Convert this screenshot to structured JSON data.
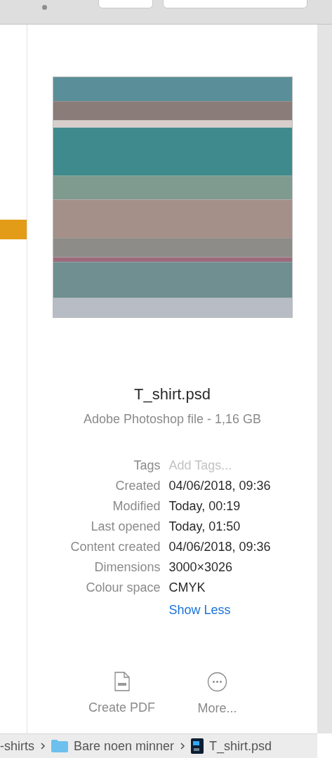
{
  "file": {
    "name": "T_shirt.psd",
    "subtitle": "Adobe Photoshop file - 1,16 GB"
  },
  "info": [
    {
      "label": "Tags",
      "placeholder": "Add Tags...",
      "kind": "field"
    },
    {
      "label": "Created",
      "value": "04/06/2018, 09:36",
      "kind": "text"
    },
    {
      "label": "Modified",
      "value": "Today, 00:19",
      "kind": "text"
    },
    {
      "label": "Last opened",
      "value": "Today, 01:50",
      "kind": "text"
    },
    {
      "label": "Content created",
      "value": "04/06/2018, 09:36",
      "kind": "text"
    },
    {
      "label": "Dimensions",
      "value": "3000×3026",
      "kind": "text"
    },
    {
      "label": "Colour space",
      "value": "CMYK",
      "kind": "text"
    }
  ],
  "toggle": "Show Less",
  "actions": [
    {
      "label": "Create PDF",
      "kind": "pdf"
    },
    {
      "label": "More...",
      "kind": "more"
    }
  ],
  "sidebar": {
    "items": [
      {
        "selected": true
      }
    ]
  },
  "path": [
    {
      "label": "-shirts",
      "kind": "plain"
    },
    {
      "label": "Bare noen minner",
      "kind": "folder"
    },
    {
      "label": "T_shirt.psd",
      "kind": "psd"
    }
  ]
}
